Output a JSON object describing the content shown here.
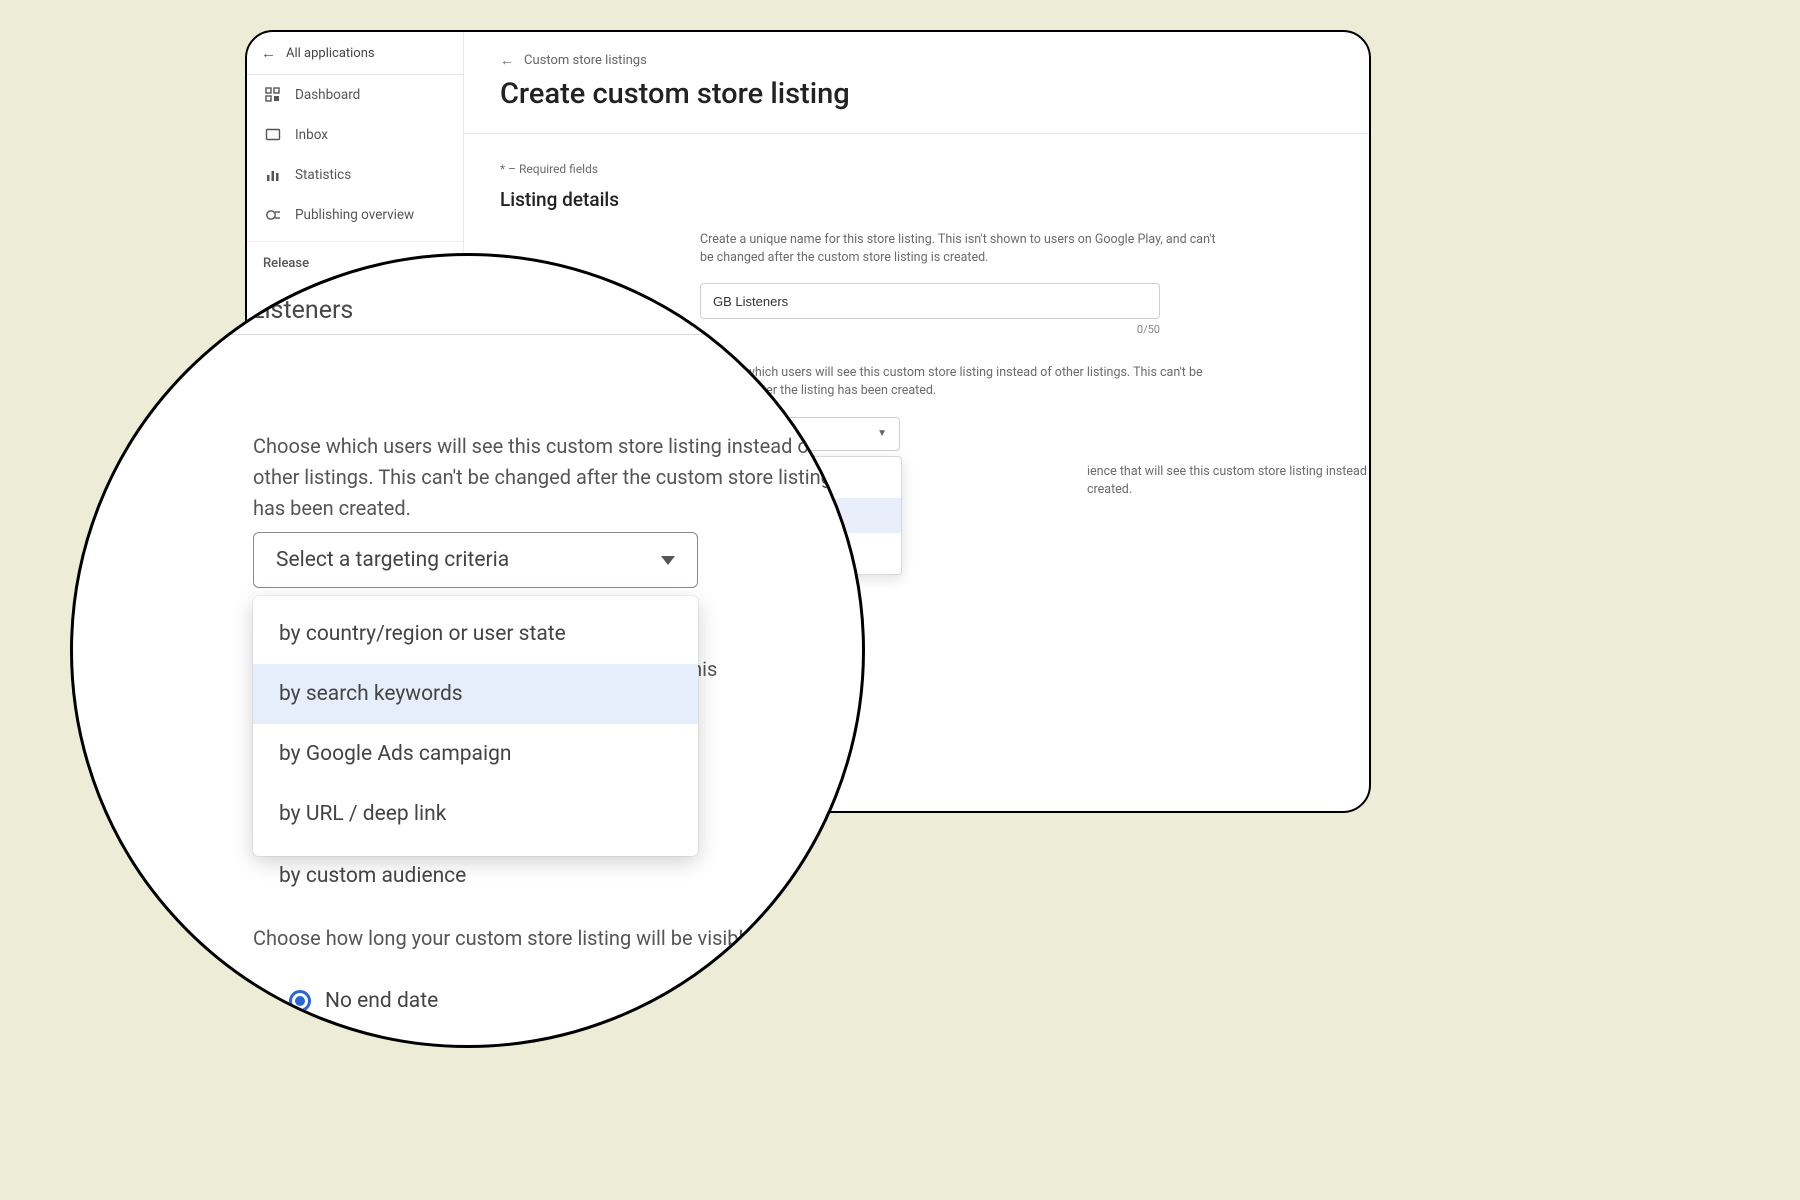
{
  "sidebar": {
    "all_apps": "All applications",
    "items": [
      {
        "label": "Dashboard"
      },
      {
        "label": "Inbox"
      },
      {
        "label": "Statistics"
      },
      {
        "label": "Publishing overview"
      }
    ],
    "release_heading": "Release"
  },
  "breadcrumb": "Custom store listings",
  "page_title": "Create custom store listing",
  "required_note": "*  –  Required fields",
  "section_listing_details": "Listing details",
  "name_help": "Create a unique name for this store listing. This isn't shown to users on Google Play, and can't be changed after the custom store listing is created.",
  "name_value": "GB Listeners",
  "name_counter": "0/50",
  "targeting_help": "Choose which users will see this custom store listing instead of other listings. This can't be changed after the listing has been created.",
  "targeting_select_placeholder": "Select a targeting criteria",
  "targeting_select_tail": "ting criteria",
  "targeting_options": {
    "country": "by country/region or user state",
    "keywords": "by search keywords",
    "ads": "by Google Ads campaign",
    "url": "by URL / deep link",
    "custom": "by custom audience"
  },
  "targeting_options_tail": {
    "country": "n or user state",
    "keywords": "ls",
    "ads": "paign"
  },
  "audience_side_help": "ience that will see this custom store listing instead of other listings. has been created.",
  "schedule_help_tail": "om store listing will be visible",
  "magnifier": {
    "listeners_label": "Listeners",
    "targeting_help": "Choose which users will see this custom store listing instead of other listings. This can't be changed after the custom store listing has been created.",
    "select_placeholder": "Select a targeting criteria",
    "bg_text_right1": "ience that will see this",
    "bg_text_right2": "has been created.",
    "schedule_help": "Choose how long your custom store listing will be visible",
    "no_end_date": "No end date"
  }
}
